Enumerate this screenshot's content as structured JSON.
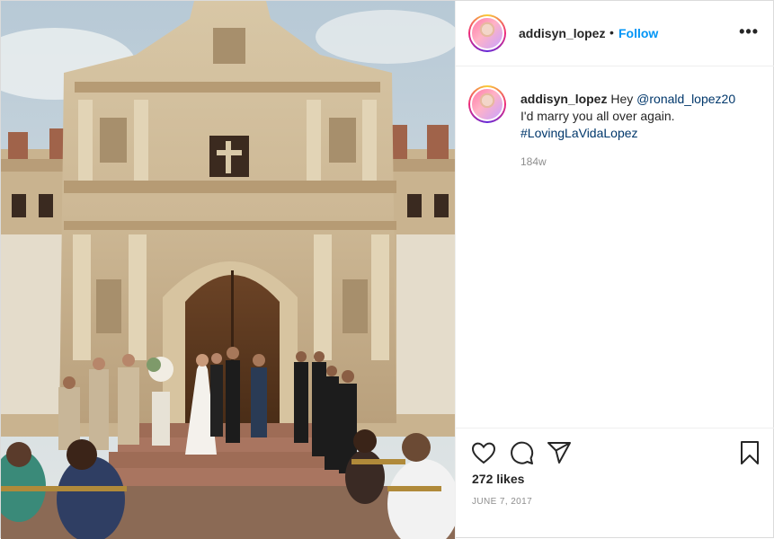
{
  "post": {
    "username": "addisyn_lopez",
    "follow_separator": "•",
    "follow_label": "Follow",
    "more_label": "•••",
    "caption": {
      "username": "addisyn_lopez",
      "prefix": "Hey",
      "mention": "@ronald_lopez20",
      "line2": "I'd marry you all over again.",
      "hashtag": "#LovingLaVidaLopez",
      "time_ago": "184w"
    },
    "likes": "272 likes",
    "date": "JUNE 7, 2017"
  },
  "icons": {
    "more": "more-options-icon",
    "like": "heart-icon",
    "comment": "comment-bubble-icon",
    "share": "paper-plane-icon",
    "save": "bookmark-icon"
  },
  "colors": {
    "link_blue": "#0095f6",
    "mention_blue": "#00376b",
    "muted": "#8e8e8e",
    "text": "#262626"
  }
}
